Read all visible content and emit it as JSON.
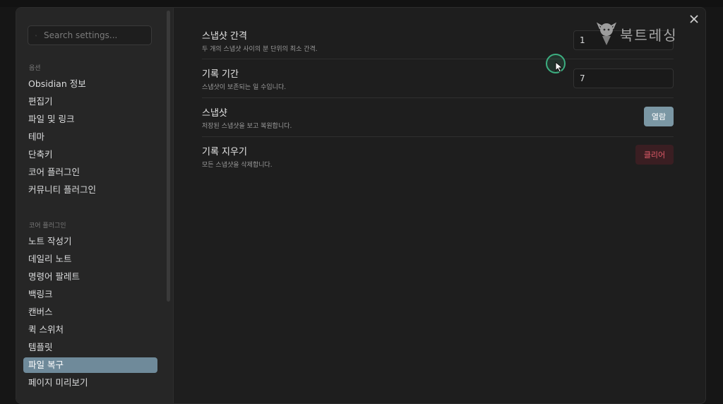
{
  "search": {
    "placeholder": "Search settings..."
  },
  "sidebar": {
    "options_title": "옵션",
    "options": [
      "Obsidian 정보",
      "편집기",
      "파일 및 링크",
      "테마",
      "단축키",
      "코어 플러그인",
      "커뮤니티 플러그인"
    ],
    "core_title": "코어 플러그인",
    "core": [
      "노트 작성기",
      "데일리 노트",
      "명령어 팔레트",
      "백링크",
      "캔버스",
      "퀵 스위처",
      "템플릿",
      "파일 복구",
      "페이지 미리보기"
    ],
    "active": "파일 복구"
  },
  "settings": [
    {
      "name": "스냅샷 간격",
      "desc": "두 개의 스냅샷 사이의 분 단위의 최소 간격.",
      "value": "1"
    },
    {
      "name": "기록 기간",
      "desc": "스냅샷이 보존되는 일 수입니다.",
      "value": "7"
    },
    {
      "name": "스냅샷",
      "desc": "저장된 스냅샷을 보고 복원합니다.",
      "button": "열람"
    },
    {
      "name": "기록 지우기",
      "desc": "모든 스냅샷을 삭제합니다.",
      "button": "클리어"
    }
  ],
  "watermark": {
    "text": "북트레싱"
  },
  "colors": {
    "accent": "#7b97a4",
    "danger": "#e05a68",
    "active_nav": "#6f8a9a"
  }
}
